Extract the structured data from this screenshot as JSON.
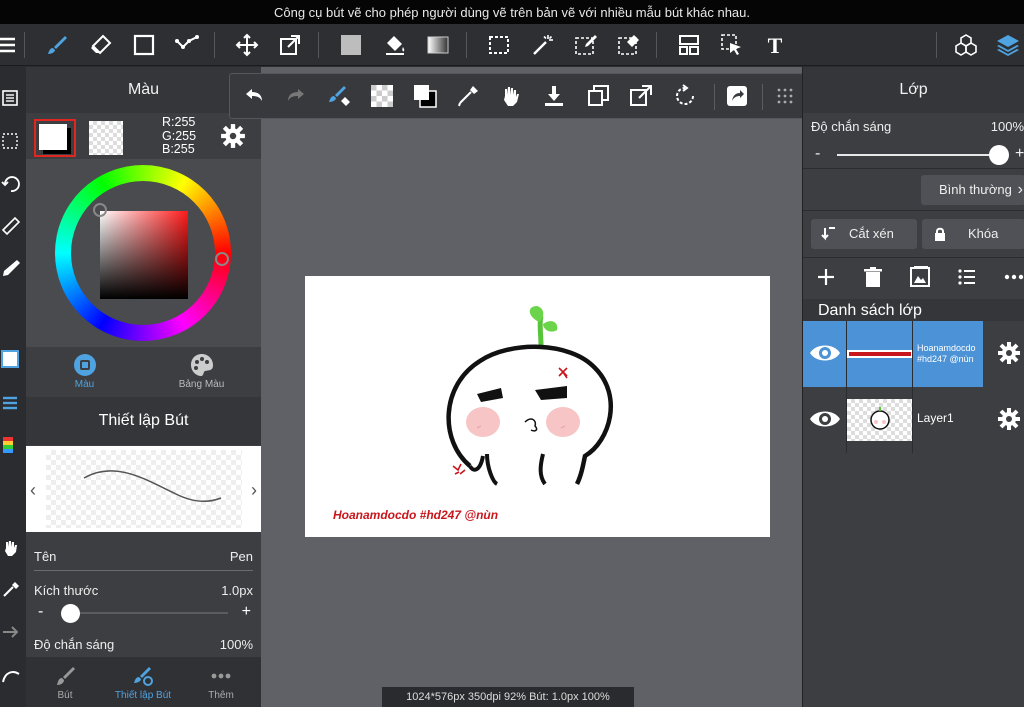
{
  "tooltip": "Công cụ bút vẽ cho phép người dùng vẽ trên bản vẽ với nhiều mẫu bút khác nhau.",
  "toolbar": {
    "icons": [
      "menu-icon",
      "brush-icon",
      "eraser-icon",
      "rectangle-icon",
      "dot-line-icon",
      "move-icon",
      "transform-icon",
      "fill-square-icon",
      "bucket-icon",
      "gradient-icon",
      "select-rect-icon",
      "magic-wand-icon",
      "select-pen-icon",
      "select-eraser-icon",
      "panel-icon",
      "select-layer-icon",
      "text-icon",
      "material-icon",
      "layers-icon"
    ]
  },
  "color_panel": {
    "title": "Màu",
    "rgb": {
      "r": "R:255",
      "g": "G:255",
      "b": "B:255"
    },
    "tabs": {
      "color": "Màu",
      "palette": "Bảng Màu"
    },
    "active_tab_color": "#4fa3e0"
  },
  "brush_panel": {
    "title": "Thiết lập Bút",
    "name_label": "Tên",
    "name_value": "Pen",
    "size_label": "Kích thước",
    "size_value": "1.0px",
    "size_slider_fraction": 0.05,
    "opacity_label": "Độ chắn sáng",
    "opacity_value": "100%",
    "minus": "-",
    "plus": "+",
    "bottom_tabs": {
      "brush": "Bút",
      "brush_settings": "Thiết lập Bút",
      "more": "Thêm"
    }
  },
  "canvas": {
    "signature": "Hoanamdocdo #hd247 @nùn",
    "status": "1024*576px 350dpi 92% Bút: 1.0px 100%"
  },
  "layer_panel": {
    "title": "Lớp",
    "opacity_label": "Độ chắn sáng",
    "opacity_value": "100%",
    "opacity_slider_fraction": 1.0,
    "minus": "-",
    "plus": "+",
    "blend_mode": "Bình thường",
    "clip_label": "Cắt xén",
    "lock_label": "Khóa",
    "list_title": "Danh sách lớp",
    "layers": [
      {
        "name": "Hoanamdocdo #hd247 @nùn",
        "selected": true
      },
      {
        "name": "Layer1",
        "selected": false
      }
    ],
    "selected_color": "#4b92d6"
  }
}
